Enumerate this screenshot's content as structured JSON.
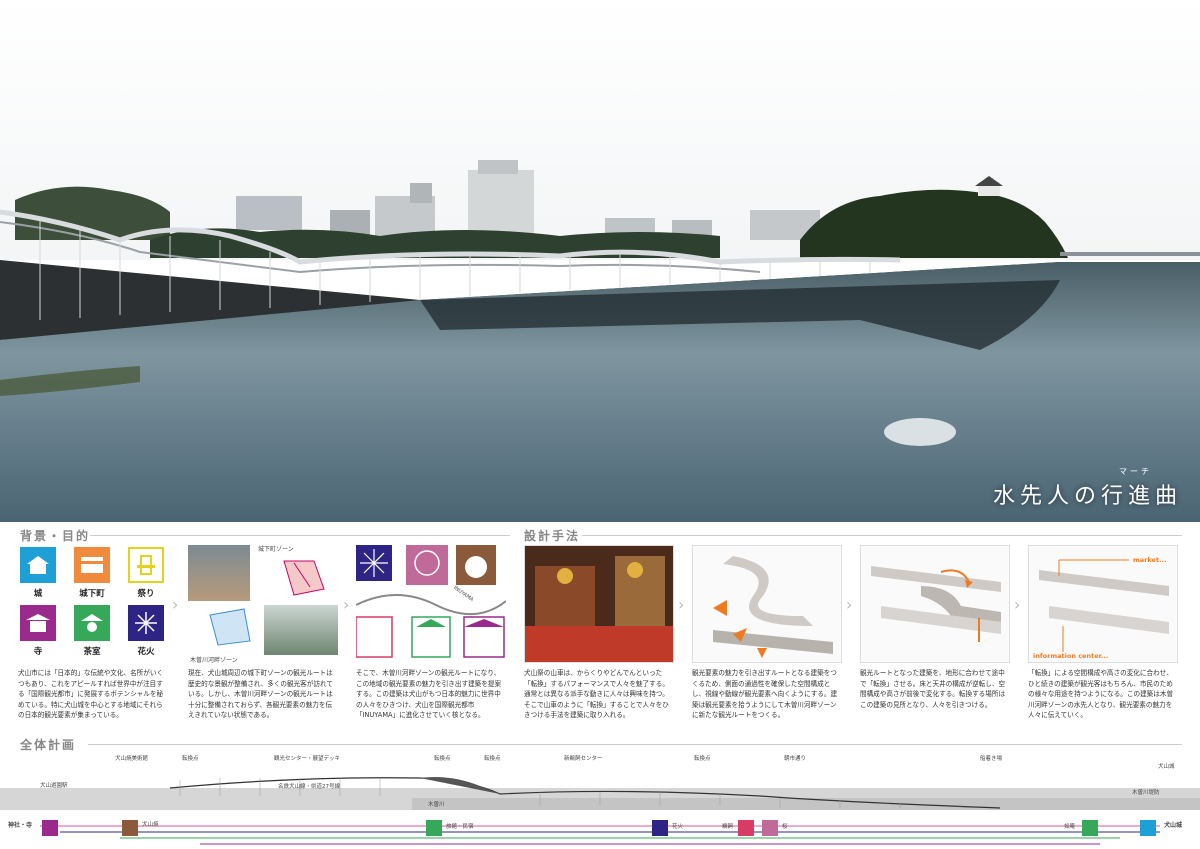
{
  "hero": {
    "title": "水先人の行進曲",
    "ruby": "マーチ"
  },
  "sections": {
    "background": "背景・目的",
    "design": "設計手法",
    "overall": "全体計画"
  },
  "icons": [
    {
      "label": "城",
      "color": "#1ea0d6"
    },
    {
      "label": "城下町",
      "color": "#f08a3c"
    },
    {
      "label": "祭り",
      "color": "#e6d21c"
    },
    {
      "label": "寺",
      "color": "#9a2a8c"
    },
    {
      "label": "茶室",
      "color": "#35a85a"
    },
    {
      "label": "花火",
      "color": "#2e2486"
    }
  ],
  "panel2": {
    "zone_a": "城下町ゾーン",
    "zone_b": "木曽川河畔ゾーン"
  },
  "panel3": {
    "tag": "INUYAMA"
  },
  "panel7": {
    "market": "market...",
    "info": "information center..."
  },
  "texts": [
    "犬山市には「日本的」な伝統や文化、名所がいくつもあり、これをアピールすれば世界中が注目する「国際観光都市」に発展するポテンシャルを秘めている。特に犬山城を中心とする地域にそれらの日本的観光要素が集まっている。",
    "現在、犬山城周辺の城下町ゾーンの観光ルートは歴史的な景観が整備され、多くの観光客が訪れている。しかし、木曽川河畔ゾーンの観光ルートは十分に整備されておらず、各観光要素の魅力を伝えきれていない状態である。",
    "そこで、木曽川河畔ゾーンの観光ルートになり、この地域の観光要素の魅力を引き出す建築を提案する。この建築は犬山がもつ日本的魅力に世界中の人々をひきつけ、犬山を国際観光都市「INUYAMA」に進化させていく核となる。",
    "犬山祭の山車は、からくりやどんでんといった「転換」するパフォーマンスで人々を魅了する。通常とは異なる派手な動きに人々は興味を持つ。そこで山車のように「転換」することで人々をひきつける手法を建築に取り入れる。",
    "観光要素の魅力を引き出すルートとなる建築をつくるため、側面の通過性を確保した空間構成とし、視線や動線が観光要素へ向くようにする。建築は観光要素を拾うようにして木曽川河畔ゾーンに新たな観光ルートをつくる。",
    "観光ルートとなった建築を、地形に合わせて途中で「転換」させる。床と天井の構成が逆転し、空間構成や高さが前後で変化する。転換する場所はこの建築の見所となり、人々を引きつける。",
    "「転換」による空間構成や高さの変化に合わせ、ひと続きの建築が観光客はもちろん、市民のための様々な用途を持つようになる。この建築は木曽川河畔ゾーンの水先人となり、観光要素の魅力を人々に伝えていく。"
  ],
  "plan": {
    "top_labels": [
      "犬山焼美術館",
      "転換点",
      "観光センター・展望デッキ",
      "転換点",
      "転換点",
      "新鵜飼センター",
      "転換点",
      "朝市通り",
      "船着き場"
    ],
    "left_station": "犬山遊園駅",
    "right_top": "犬山城",
    "mid_label": "名鉄犬山線・県道27号線",
    "river": "木曽川",
    "right_river": "木曽川堤防",
    "bottom_left": "神社・寺",
    "bottom_right": "犬山城",
    "route_labels": [
      "犬山焼",
      "旅館・民宿",
      "花火",
      "鵜飼",
      "桜",
      "如庵"
    ]
  }
}
